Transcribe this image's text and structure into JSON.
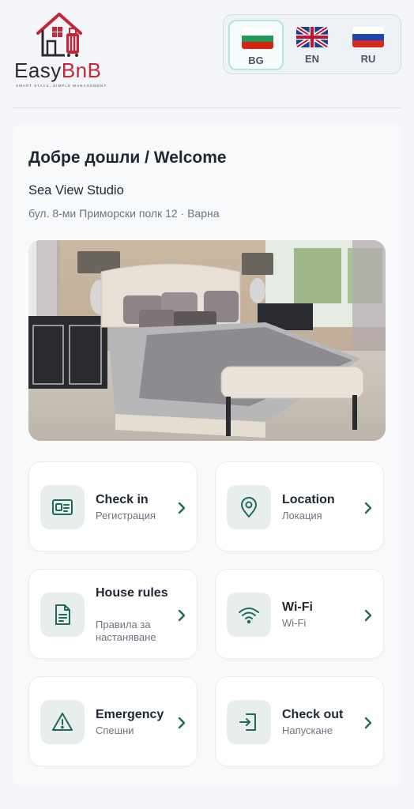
{
  "brand": {
    "name_part1": "Easy",
    "name_part2": "BnB",
    "tagline": "SMART STAYS, SIMPLE MANAGEMENT",
    "accent_color": "#c0283a"
  },
  "languages": [
    {
      "code": "BG",
      "flag": "bulgaria-flag",
      "active": true
    },
    {
      "code": "EN",
      "flag": "uk-flag",
      "active": false
    },
    {
      "code": "RU",
      "flag": "russia-flag",
      "active": false
    }
  ],
  "welcome": {
    "title": "Добре дошли / Welcome",
    "property_name": "Sea View Studio",
    "address": "бул. 8-ми Приморски полк 12 · Варна"
  },
  "photo": {
    "alt_icon": "bedroom-photo"
  },
  "tiles": [
    {
      "title": "Check in",
      "subtitle": "Регистрация",
      "icon": "id-card-icon"
    },
    {
      "title": "Location",
      "subtitle": "Локация",
      "icon": "map-pin-icon"
    },
    {
      "title": "House rules",
      "subtitle": "Правила за настаняване",
      "icon": "document-icon"
    },
    {
      "title": "Wi-Fi",
      "subtitle": "Wi-Fi",
      "icon": "wifi-icon"
    },
    {
      "title": "Emergency",
      "subtitle": "Спешни",
      "icon": "warning-icon"
    },
    {
      "title": "Check out",
      "subtitle": "Напускане",
      "icon": "exit-icon"
    }
  ],
  "colors": {
    "teal": "#1f6b5e",
    "icon_bg": "#e8eeec"
  }
}
